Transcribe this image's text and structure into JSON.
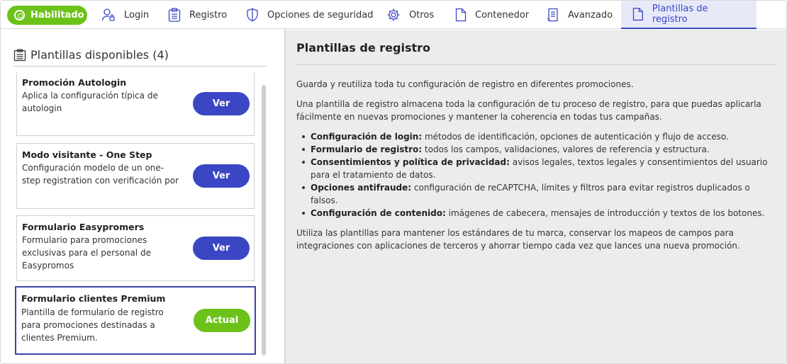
{
  "tabs": {
    "status": "Habilitado",
    "items": [
      {
        "label": "Login",
        "icon": "user-lock-icon"
      },
      {
        "label": "Registro",
        "icon": "clipboard-icon"
      },
      {
        "label": "Opciones de seguridad",
        "icon": "shield-icon"
      },
      {
        "label": "Otros",
        "icon": "gear-icon"
      },
      {
        "label": "Contenedor",
        "icon": "file-icon"
      },
      {
        "label": "Avanzado",
        "icon": "document-icon"
      },
      {
        "label": "Plantillas de registro",
        "icon": "file-icon"
      }
    ],
    "active": "Plantillas de registro"
  },
  "left": {
    "title": "Plantillas disponibles (4)",
    "templates": [
      {
        "title": "Promoción Autologin",
        "desc": "Aplica la configuración típica de autologin",
        "button": "Ver"
      },
      {
        "title": "Modo visitante - One Step",
        "desc": "Configuración modelo de un one-step registration con verificación por email,",
        "button": "Ver"
      },
      {
        "title": "Formulario Easypromers",
        "desc": "Formulario para promociones exclusivas para el personal de Easypromos",
        "button": "Ver"
      },
      {
        "title": "Formulario clientes Premium",
        "desc": "Plantilla de formulario de registro para promociones destinadas a clientes Premium.",
        "button": "Actual"
      }
    ]
  },
  "right": {
    "title": "Plantillas de registro",
    "intro1": "Guarda y reutiliza toda tu configuración de registro en diferentes promociones.",
    "intro2": "Una plantilla de registro almacena toda la configuración de tu proceso de registro, para que puedas aplicarla fácilmente en nuevas promociones y mantener la coherencia en todas tus campañas.",
    "bullets": [
      {
        "term": "Configuración de login:",
        "text": " métodos de identificación, opciones de autenticación y flujo de acceso."
      },
      {
        "term": "Formulario de registro:",
        "text": " todos los campos, validaciones, valores de referencia y estructura."
      },
      {
        "term": "Consentimientos y política de privacidad:",
        "text": " avisos legales, textos legales y consentimientos del usuario para el tratamiento de datos."
      },
      {
        "term": "Opciones antifraude:",
        "text": " configuración de reCAPTCHA, límites y filtros para evitar registros duplicados o falsos."
      },
      {
        "term": "Configuración de contenido:",
        "text": " imágenes de cabecera, mensajes de introducción y textos de los botones."
      }
    ],
    "outro": "Utiliza las plantillas para mantener los estándares de tu marca, conservar los mapeos de campos para integraciones con aplicaciones de terceros y ahorrar tiempo cada vez que lances una nueva promoción."
  },
  "colors": {
    "accent_blue": "#3a46c4",
    "success_green": "#6cc219",
    "active_tab_bg": "#e7e9f8",
    "right_panel_bg": "#ececec"
  }
}
